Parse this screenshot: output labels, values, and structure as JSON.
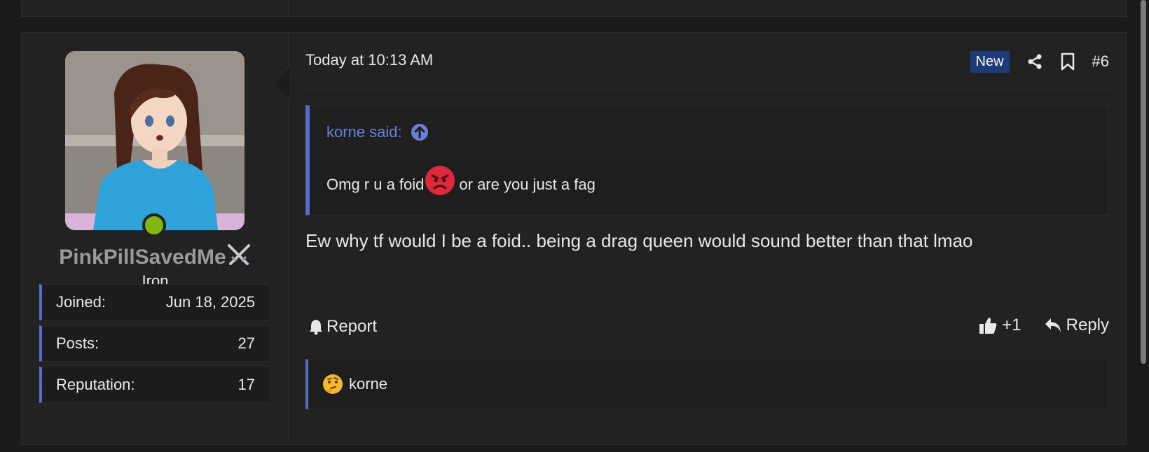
{
  "post": {
    "date": "Today at 10:13 AM",
    "new_badge": "New",
    "number": "#6",
    "quote": {
      "author": "korne said:",
      "text_before": "Omg r u a foid",
      "text_after": " or are you just a fag"
    },
    "message": "Ew why tf would I be a foid.. being a drag queen would sound better than that lmao",
    "report_label": "Report",
    "like_count": "+1",
    "reply_label": "Reply",
    "reaction_user": "korne"
  },
  "user": {
    "name": "PinkPillSavedMe",
    "title": "Iron",
    "stats": [
      {
        "label": "Joined:",
        "value": "Jun 18, 2025"
      },
      {
        "label": "Posts:",
        "value": "27"
      },
      {
        "label": "Reputation:",
        "value": "17"
      }
    ]
  },
  "icons": {
    "share": "share-icon",
    "bookmark": "bookmark-icon",
    "quote_up": "arrow-up-circle-icon",
    "report": "bell-icon",
    "like": "thumbs-up-icon",
    "reply": "reply-icon",
    "rank": "crossed-swords-icon",
    "angry": "angry-face-emoji",
    "thinking": "thinking-face-emoji"
  },
  "colors": {
    "accent": "#5a6bc2",
    "quote_author": "#6a7fd8",
    "new_badge_bg": "#1f3a7a",
    "online": "#7fb80e",
    "username": "#9a9a9a"
  }
}
